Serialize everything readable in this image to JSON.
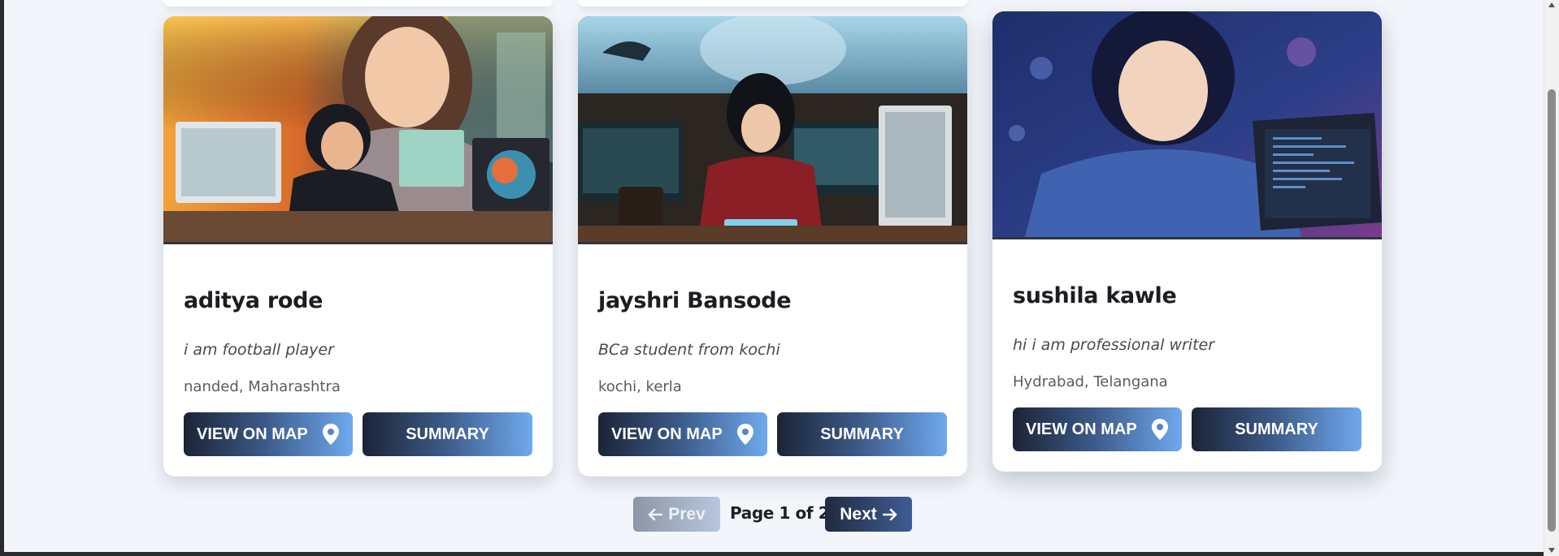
{
  "profiles": [
    {
      "name": "aditya rode",
      "bio": "i am football player",
      "location": "nanded, Maharashtra",
      "map_label": "VIEW ON MAP",
      "summary_label": "SUMMARY"
    },
    {
      "name": "jayshri Bansode",
      "bio": "BCa student from kochi",
      "location": "kochi, kerla",
      "map_label": "VIEW ON MAP",
      "summary_label": "SUMMARY"
    },
    {
      "name": "sushila kawle",
      "bio": "hi i am professional writer",
      "location": "Hydrabad, Telangana",
      "map_label": "VIEW ON MAP",
      "summary_label": "SUMMARY"
    }
  ],
  "pagination": {
    "prev_label": "Prev",
    "page_info": "Page 1 of 2",
    "next_label": "Next"
  },
  "icons": {
    "map_button": "map-pin-icon",
    "prev_button": "arrow-left-icon",
    "next_button": "arrow-right-icon"
  },
  "colors": {
    "page_background": "#f2f5fa",
    "button_gradient_start": "#1b2436",
    "button_gradient_end": "#6fa9ee",
    "prev_disabled": "#9aa4b6",
    "next_active": "#2d3c5c"
  }
}
